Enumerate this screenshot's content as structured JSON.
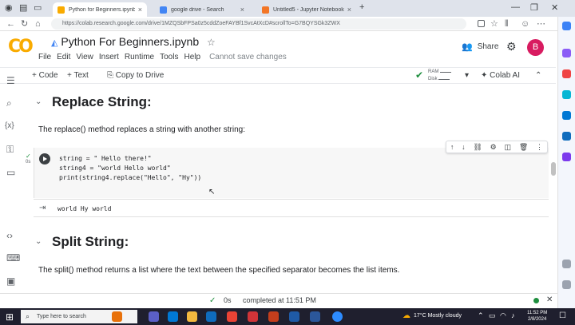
{
  "browser": {
    "tabs": [
      {
        "label": "Python for Beginners.ipynb - Co",
        "active": true,
        "color": "#f9ab00"
      },
      {
        "label": "google drive - Search",
        "active": false,
        "color": "#4285f4"
      },
      {
        "label": "Untitled5 - Jupyter Notebook",
        "active": false,
        "color": "#f37626"
      }
    ],
    "new_tab": "+",
    "url": "https://colab.research.google.com/drive/1MZQSbFPSa0z5cddZoeFAYBf1SvcAtXcD#scrollTo=G7BQYSGk3ZWX"
  },
  "colab": {
    "logo_text": "CO",
    "title": "Python For Beginners.ipynb",
    "menu": [
      "File",
      "Edit",
      "View",
      "Insert",
      "Runtime",
      "Tools",
      "Help"
    ],
    "save_status": "Cannot save changes",
    "share_label": "Share",
    "avatar_letter": "B",
    "toolbar": {
      "code": "+ Code",
      "text": "+ Text",
      "copy_to_drive": "Copy to Drive",
      "ram": "RAM",
      "disk": "Disk",
      "colab_ai": "Colab AI"
    }
  },
  "notebook": {
    "section1": {
      "heading": "Replace String:",
      "paragraph": "The replace() method replaces a string with another string:"
    },
    "cell": {
      "exec_time": "0s",
      "code_lines": [
        "string = \" Hello there!\"",
        "string4 = \"world Hello world\"",
        "print(string4.replace(\"Hello\", \"Hy\"))"
      ],
      "output": "world Hy world"
    },
    "section2": {
      "heading": "Split String:",
      "paragraph": "The split() method returns a list where the text between the specified separator becomes the list items."
    }
  },
  "status": {
    "exec": "0s",
    "message": "completed at 11:51 PM"
  },
  "taskbar": {
    "search_placeholder": "Type here to search",
    "weather": "17°C  Mostly cloudy",
    "time": "11:52 PM",
    "date": "2/8/2024"
  }
}
